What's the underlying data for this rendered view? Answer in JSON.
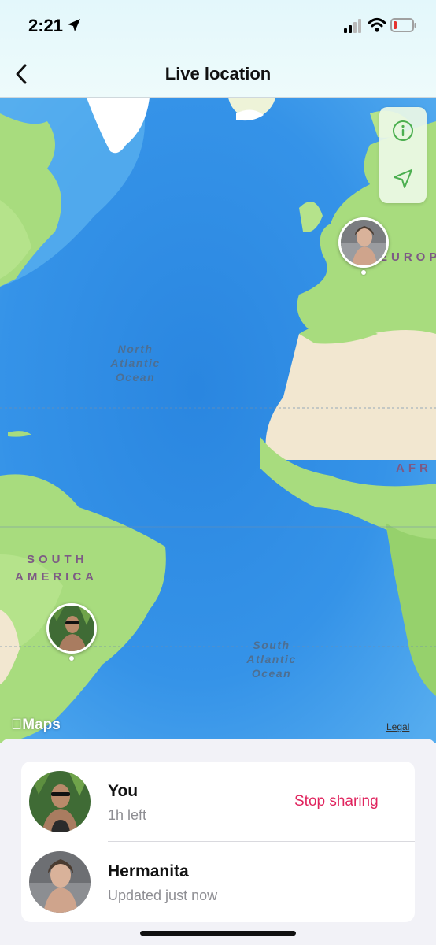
{
  "status_bar": {
    "time": "2:21"
  },
  "header": {
    "title": "Live location"
  },
  "map": {
    "ocean_labels": {
      "north": "North\nAtlantic\nOcean",
      "south": "South\nAtlantic\nOcean"
    },
    "continent_labels": {
      "europe": "EUROP",
      "africa": "AFR",
      "south_america_1": "SOUTH",
      "south_america_2": "AMERICA"
    },
    "attribution": "Maps",
    "legal": "Legal"
  },
  "people": [
    {
      "name": "You",
      "status": "1h left",
      "action": "Stop sharing"
    },
    {
      "name": "Hermanita",
      "status": "Updated just now"
    }
  ],
  "colors": {
    "accent_red": "#e0245e",
    "ocean": "#2f8fe6",
    "land": "#a8dc7e"
  }
}
